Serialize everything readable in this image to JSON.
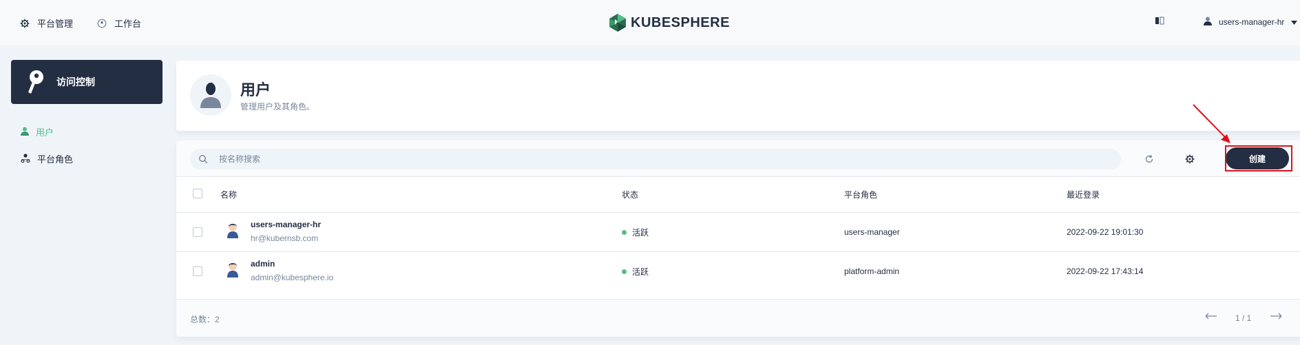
{
  "topbar": {
    "platform_label": "平台管理",
    "workbench_label": "工作台",
    "logo_text": "KUBESPHERE",
    "username": "users-manager-hr"
  },
  "sidebar": {
    "section_title": "访问控制",
    "items": [
      {
        "label": "用户",
        "active": true
      },
      {
        "label": "平台角色",
        "active": false
      }
    ]
  },
  "header": {
    "title": "用户",
    "description": "管理用户及其角色。"
  },
  "toolbar": {
    "search_placeholder": "按名称搜索",
    "create_label": "创建"
  },
  "table": {
    "columns": [
      "名称",
      "状态",
      "平台角色",
      "最近登录"
    ],
    "rows": [
      {
        "name": "users-manager-hr",
        "email": "hr@kubernsb.com",
        "status": "活跃",
        "role": "users-manager",
        "last_login": "2022-09-22 19:01:30"
      },
      {
        "name": "admin",
        "email": "admin@kubesphere.io",
        "status": "活跃",
        "role": "platform-admin",
        "last_login": "2022-09-22 17:43:14"
      }
    ]
  },
  "footer": {
    "total": "总数：2",
    "page": "1 / 1"
  },
  "colors": {
    "brand_dark": "#242e42",
    "accent_green": "#55bc8a",
    "annotation_red": "#e0101a"
  },
  "icons": [
    "gear-icon",
    "compass-icon",
    "kubesphere-logo",
    "book-icon",
    "user-icon",
    "key-icon",
    "search-icon",
    "refresh-icon",
    "settings-icon",
    "arrow-left-icon",
    "arrow-right-icon"
  ]
}
